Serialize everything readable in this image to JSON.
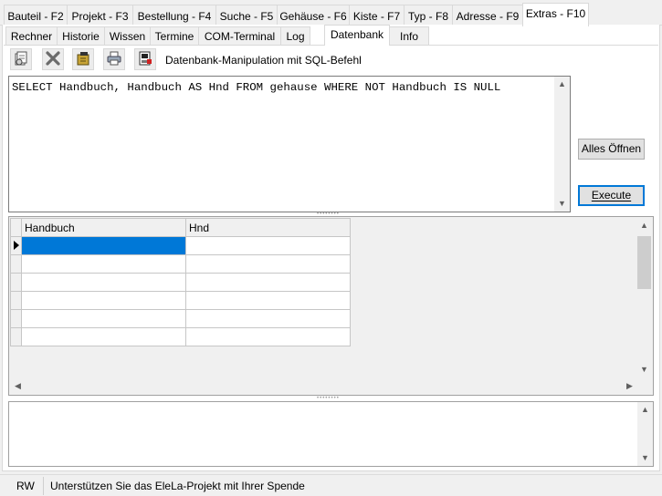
{
  "main_tabs": [
    {
      "label": "Bauteil - F2"
    },
    {
      "label": "Projekt - F3"
    },
    {
      "label": "Bestellung - F4"
    },
    {
      "label": "Suche - F5"
    },
    {
      "label": "Gehäuse - F6"
    },
    {
      "label": "Kiste - F7"
    },
    {
      "label": "Typ - F8"
    },
    {
      "label": "Adresse - F9"
    },
    {
      "label": "Extras - F10",
      "active": true
    }
  ],
  "sub_tabs": [
    {
      "label": "Rechner"
    },
    {
      "label": "Historie"
    },
    {
      "label": "Wissen"
    },
    {
      "label": "Termine"
    },
    {
      "label": "COM-Terminal"
    },
    {
      "label": "Log"
    },
    {
      "label": "Datenbank",
      "active": true
    },
    {
      "label": "Info"
    }
  ],
  "toolbar": {
    "label": "Datenbank-Manipulation mit SQL-Befehl",
    "buttons": [
      {
        "icon": "open-query-icon"
      },
      {
        "icon": "delete-icon"
      },
      {
        "icon": "clear-icon"
      },
      {
        "icon": "print-icon"
      },
      {
        "icon": "export-icon"
      }
    ]
  },
  "sql": {
    "text": "SELECT Handbuch, Handbuch AS Hnd FROM gehause WHERE NOT Handbuch IS NULL"
  },
  "buttons": {
    "open_all": "Alles Öffnen",
    "execute": "Execute"
  },
  "grid": {
    "columns": [
      "Handbuch",
      "Hnd"
    ],
    "rows": [
      [
        "",
        ""
      ],
      [
        "",
        ""
      ],
      [
        "",
        ""
      ],
      [
        "",
        ""
      ],
      [
        "",
        ""
      ],
      [
        "",
        ""
      ]
    ]
  },
  "status": {
    "mode": "RW",
    "message": "Unterstützen Sie das EleLa-Projekt mit Ihrer Spende"
  },
  "colors": {
    "accent": "#0078d7",
    "selection": "#0078d7"
  }
}
